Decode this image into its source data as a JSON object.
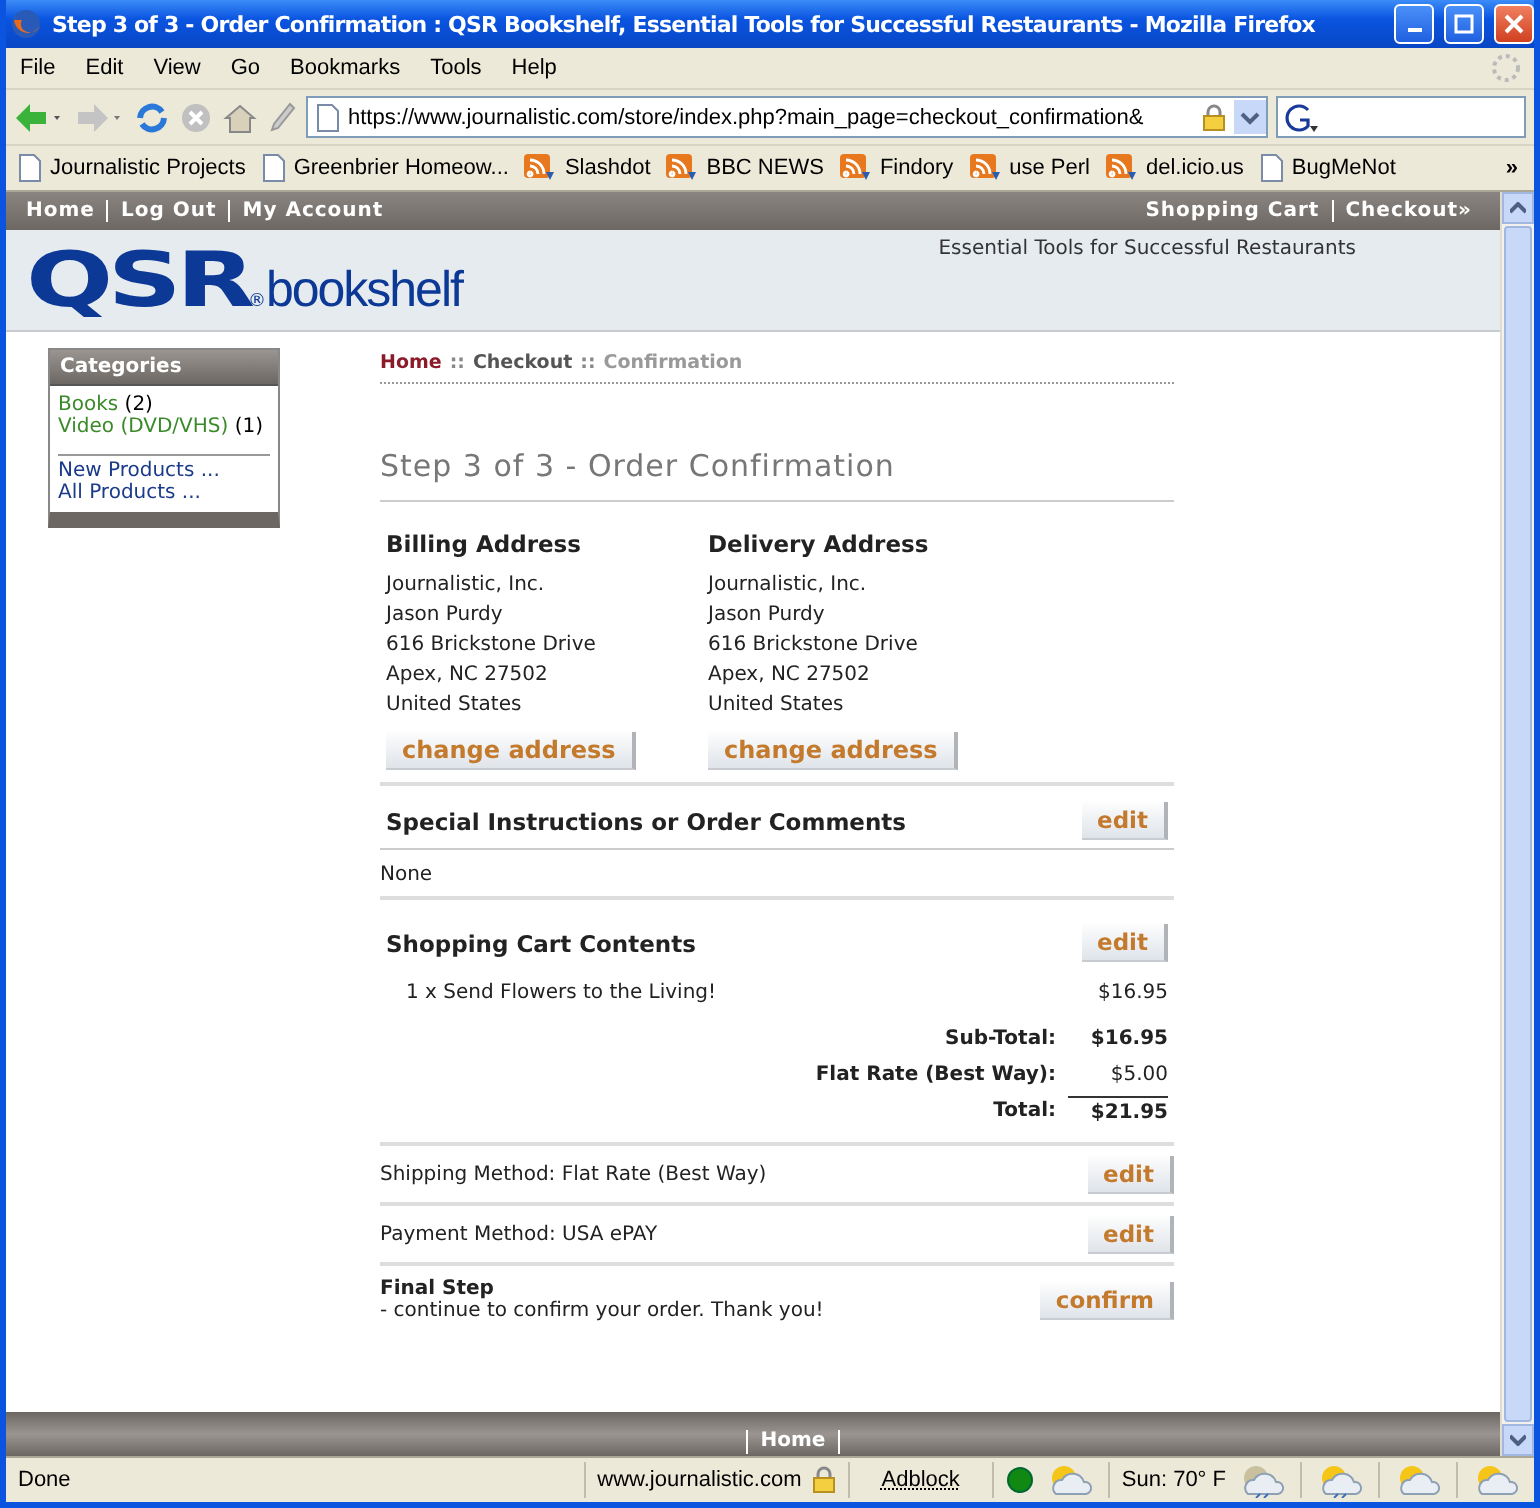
{
  "window": {
    "title": "Step 3 of 3 - Order Confirmation : QSR Bookshelf, Essential Tools for Successful Restaurants - Mozilla Firefox"
  },
  "menu": [
    "File",
    "Edit",
    "View",
    "Go",
    "Bookmarks",
    "Tools",
    "Help"
  ],
  "address_bar": {
    "url": "https://www.journalistic.com/store/index.php?main_page=checkout_confirmation&"
  },
  "bookmarks": [
    {
      "label": "Journalistic Projects",
      "kind": "page"
    },
    {
      "label": "Greenbrier Homeow...",
      "kind": "page"
    },
    {
      "label": "Slashdot",
      "kind": "feed"
    },
    {
      "label": "BBC NEWS",
      "kind": "feed"
    },
    {
      "label": "Findory",
      "kind": "feed"
    },
    {
      "label": "use Perl",
      "kind": "feed"
    },
    {
      "label": "del.icio.us",
      "kind": "feed"
    },
    {
      "label": "BugMeNot",
      "kind": "page"
    }
  ],
  "bookmarks_overflow": "»",
  "site_nav": {
    "left": [
      "Home",
      "Log Out",
      "My Account"
    ],
    "right": [
      "Shopping Cart",
      "Checkout»"
    ]
  },
  "logo": {
    "brand": "QSR",
    "mark": "®",
    "name": "bookshelf"
  },
  "tagline": "Essential Tools for Successful Restaurants",
  "sidebar": {
    "title": "Categories",
    "categories": [
      {
        "label": "Books",
        "count": "(2)"
      },
      {
        "label": "Video (DVD/VHS)",
        "count": "(1)"
      }
    ],
    "links": [
      "New Products ...",
      "All Products ..."
    ]
  },
  "breadcrumb": [
    {
      "text": "Home",
      "kind": "home"
    },
    {
      "text": "::",
      "kind": "sep"
    },
    {
      "text": "Checkout",
      "kind": "link"
    },
    {
      "text": "::",
      "kind": "sep"
    },
    {
      "text": "Confirmation",
      "kind": "current"
    }
  ],
  "heading": "Step 3 of 3 - Order Confirmation",
  "addresses": [
    {
      "title": "Billing Address",
      "lines": [
        "Journalistic, Inc.",
        "Jason Purdy",
        "616 Brickstone Drive",
        "Apex, NC 27502",
        "United States"
      ],
      "button": "change address"
    },
    {
      "title": "Delivery Address",
      "lines": [
        "Journalistic, Inc.",
        "Jason Purdy",
        "616 Brickstone Drive",
        "Apex, NC 27502",
        "United States"
      ],
      "button": "change address"
    }
  ],
  "comments": {
    "title": "Special Instructions or Order Comments",
    "button": "edit",
    "text": "None"
  },
  "cart": {
    "title": "Shopping Cart Contents",
    "button": "edit",
    "items": [
      {
        "text": "1 x Send Flowers to the Living!",
        "price": "$16.95"
      }
    ]
  },
  "totals": [
    {
      "label": "Sub-Total:",
      "value": "$16.95",
      "kind": "subtotal"
    },
    {
      "label": "Flat Rate (Best Way):",
      "value": "$5.00",
      "kind": "shipping"
    },
    {
      "label": "Total:",
      "value": "$21.95",
      "kind": "total"
    }
  ],
  "shipping_method": {
    "text": "Shipping Method: Flat Rate (Best Way)",
    "button": "edit"
  },
  "payment_method": {
    "text": "Payment Method: USA ePAY",
    "button": "edit"
  },
  "final_step": {
    "title": "Final Step",
    "text": "- continue to confirm your order. Thank you!",
    "button": "confirm"
  },
  "footer": {
    "link": "Home"
  },
  "status_bar": {
    "status": "Done",
    "host": "www.journalistic.com",
    "adblock": "Adblock",
    "weather": "Sun: 70° F"
  }
}
